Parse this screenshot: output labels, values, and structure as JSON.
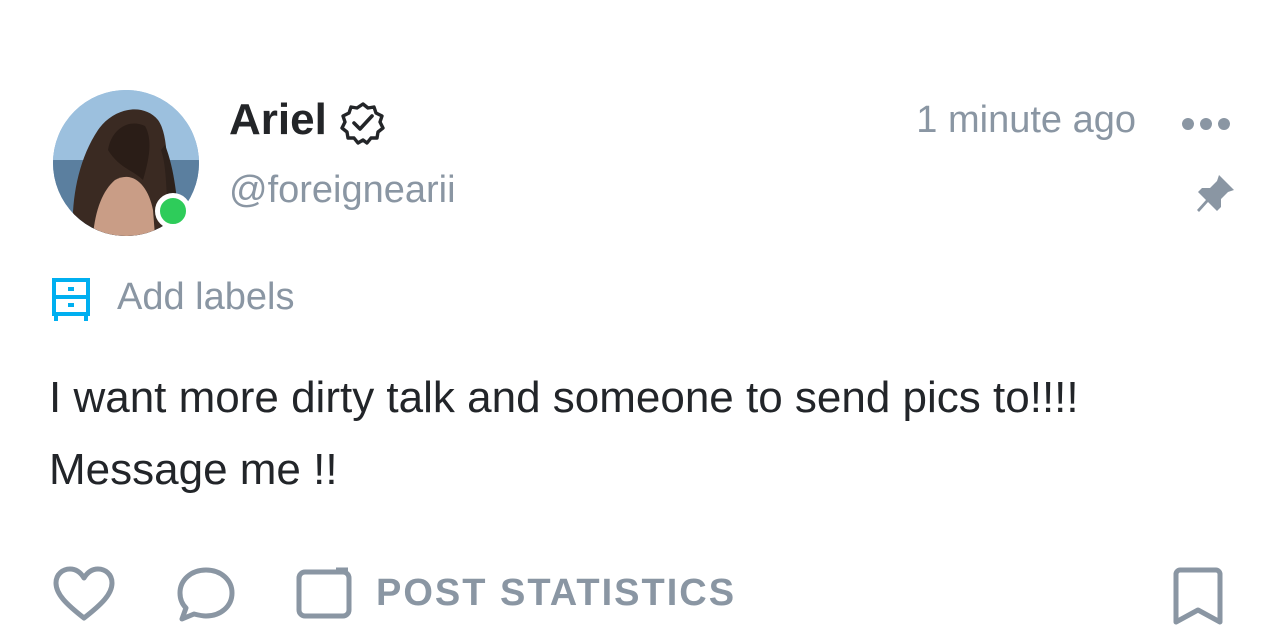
{
  "post": {
    "author": {
      "display_name": "Ariel",
      "username": "@foreignearii",
      "verified": true,
      "online": true
    },
    "timestamp": "1 minute ago",
    "labels": {
      "add_label": "Add labels"
    },
    "text": "I want more dirty talk and someone to send pics to!!!!\nMessage me !!",
    "actions": {
      "stats_label": "POST STATISTICS"
    }
  },
  "colors": {
    "online": "#2ecc5a",
    "accent": "#00aff0",
    "muted": "#8a96a3",
    "text": "#222529"
  },
  "icons": {
    "verified": "verified-badge-icon",
    "more": "more-horizontal-icon",
    "pin": "pin-icon",
    "labels": "drawer-icon",
    "like": "heart-icon",
    "comment": "comment-icon",
    "stats": "stats-icon",
    "bookmark": "bookmark-icon"
  }
}
